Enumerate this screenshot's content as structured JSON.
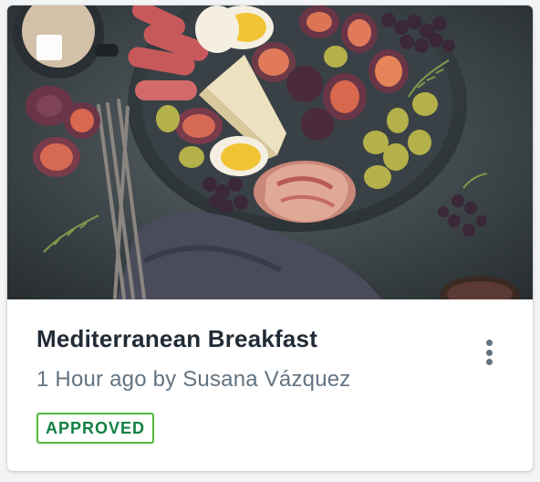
{
  "card": {
    "title": "Mediterranean Breakfast",
    "subtitle": "1 Hour ago by Susana Vázquez",
    "status_badge": "APPROVED",
    "image_subject": "mediterranean breakfast spread with figs, cheese, eggs, prosciutto, olives and grapes",
    "more_icon": "vertical-ellipsis-icon",
    "checkbox_checked": false
  },
  "colors": {
    "title": "#212b36",
    "subtitle": "#637381",
    "badge_border": "#50b83c",
    "badge_text": "#108043"
  }
}
